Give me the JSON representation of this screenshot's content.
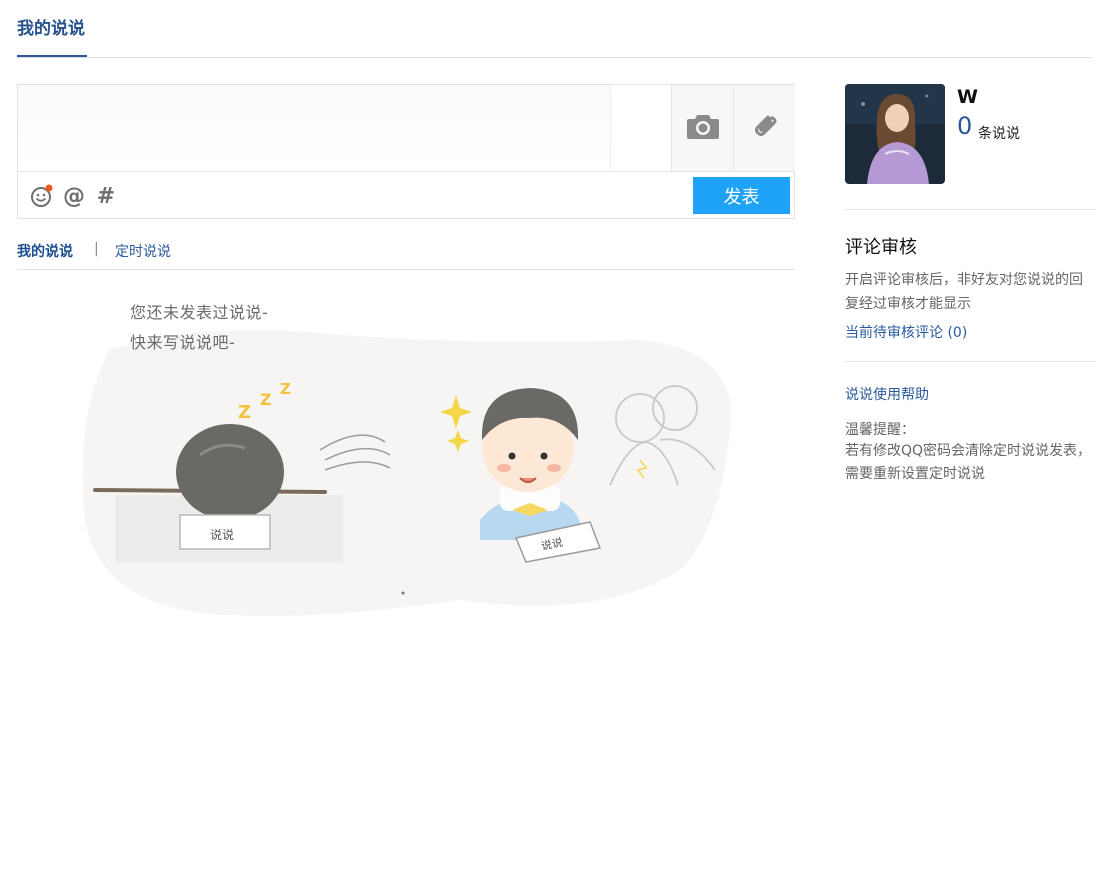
{
  "header": {
    "tab_label": "我的说说"
  },
  "composer": {
    "text_value": "",
    "camera_icon": "camera-icon",
    "link_icon": "link-icon",
    "toolbar_icons": [
      "emoji-icon",
      "at-icon",
      "hash-icon"
    ],
    "at_glyph": "@",
    "hash_glyph": "#",
    "publish_label": "发表"
  },
  "subtabs": {
    "mine": "我的说说",
    "separator": "|",
    "scheduled": "定时说说"
  },
  "empty_state": {
    "line1": "您还未发表过说说-",
    "line2": "快来写说说吧-"
  },
  "profile": {
    "username": "W",
    "post_count": "0",
    "post_count_label": "条说说"
  },
  "review": {
    "title": "评论审核",
    "description": "开启评论审核后，非好友对您说说的回复经过审核才能显示",
    "pending_link": "当前待审核评论 (0)"
  },
  "help": {
    "link": "说说使用帮助",
    "tip_title": "温馨提醒：",
    "tip_body": "若有修改QQ密码会清除定时说说发表，需要重新设置定时说说"
  },
  "colors": {
    "primary_blue": "#2d5799",
    "publish_button": "#1fa3f8"
  }
}
